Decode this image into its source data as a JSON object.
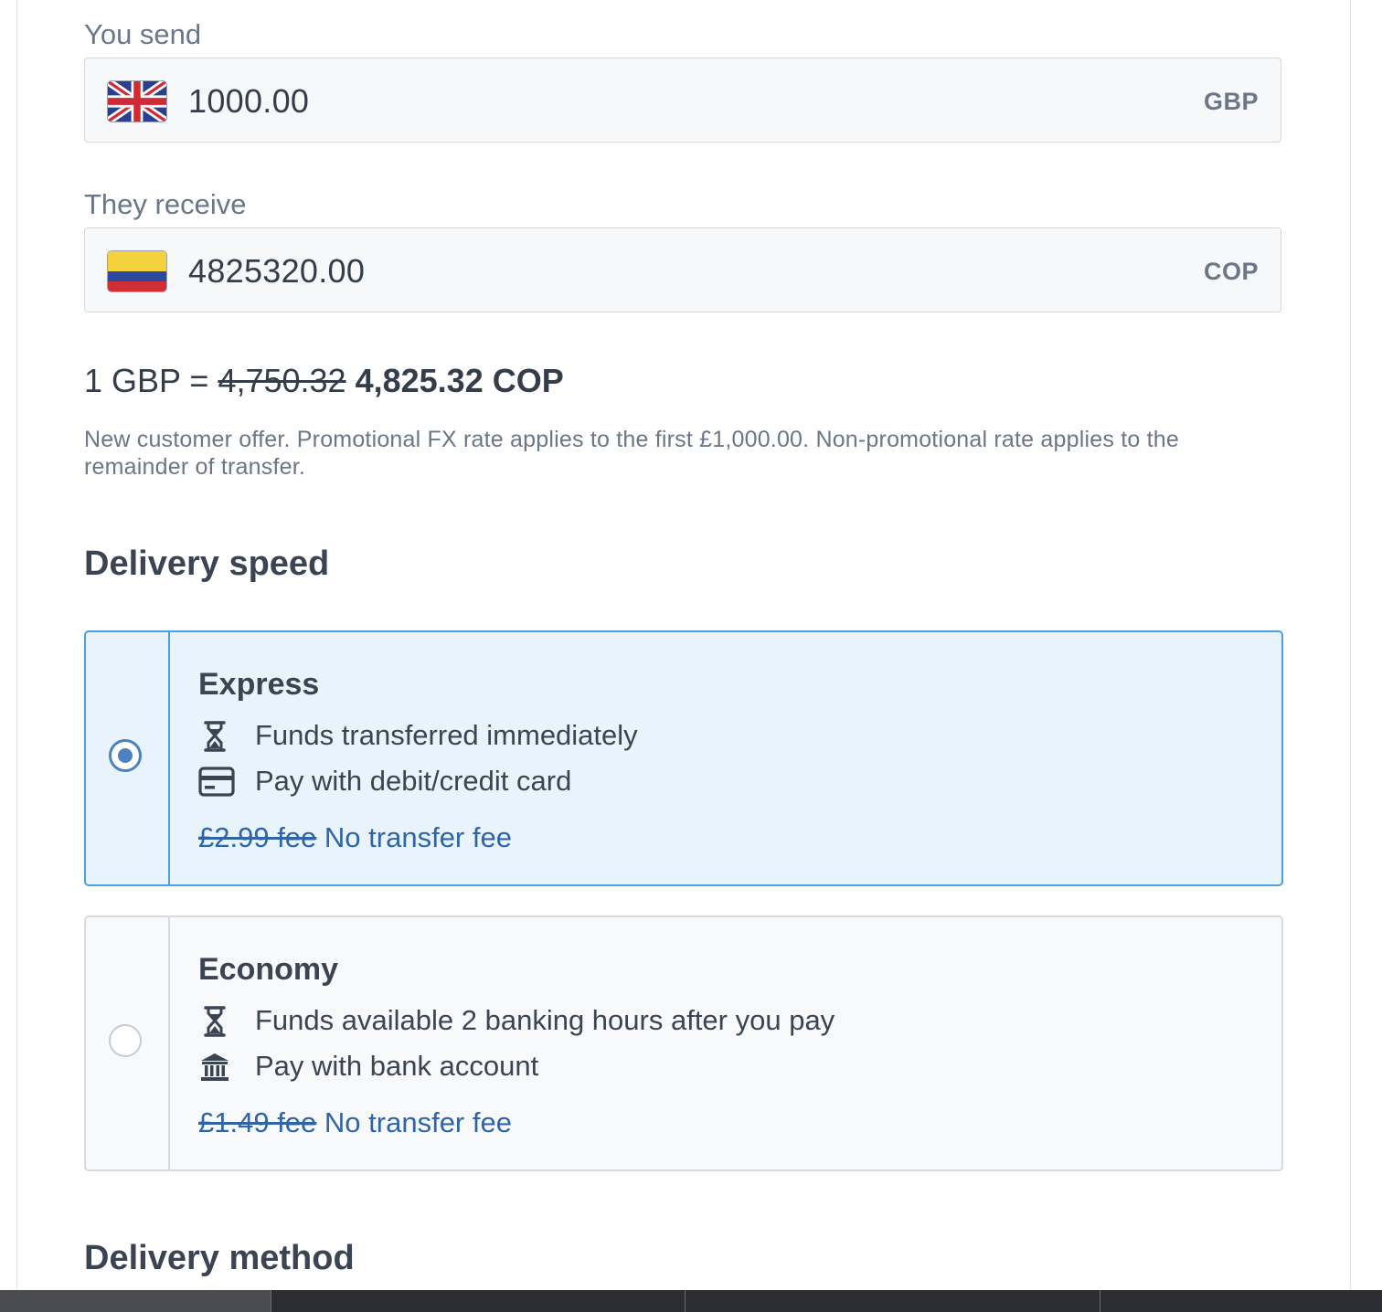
{
  "send": {
    "label": "You send",
    "amount": "1000.00",
    "currency": "GBP",
    "flag_icon": "uk-flag-icon"
  },
  "receive": {
    "label": "They receive",
    "amount": "4825320.00",
    "currency": "COP",
    "flag_icon": "colombia-flag-icon"
  },
  "rate": {
    "prefix": "1 GBP = ",
    "old": "4,750.32",
    "new": "4,825.32 COP"
  },
  "offer_note": "New customer offer. Promotional FX rate applies to the first £1,000.00. Non-promotional rate applies to the remainder of transfer.",
  "delivery_speed": {
    "heading": "Delivery speed",
    "options": [
      {
        "title": "Express",
        "selected": true,
        "features": [
          {
            "icon": "hourglass-icon",
            "text": "Funds transferred immediately"
          },
          {
            "icon": "credit-card-icon",
            "text": "Pay with debit/credit card"
          }
        ],
        "fee_old": "£2.99 fee",
        "fee_new": "No transfer fee"
      },
      {
        "title": "Economy",
        "selected": false,
        "features": [
          {
            "icon": "hourglass-icon",
            "text": "Funds available 2 banking hours after you pay"
          },
          {
            "icon": "bank-icon",
            "text": "Pay with bank account"
          }
        ],
        "fee_old": "£1.49 fee",
        "fee_new": "No transfer fee"
      }
    ]
  },
  "delivery_method": {
    "heading": "Delivery method"
  },
  "colors": {
    "accent": "#4ba0df",
    "selected_bg": "#e9f3fc",
    "fee_link": "#2f65a7",
    "text": "#3a4453"
  }
}
